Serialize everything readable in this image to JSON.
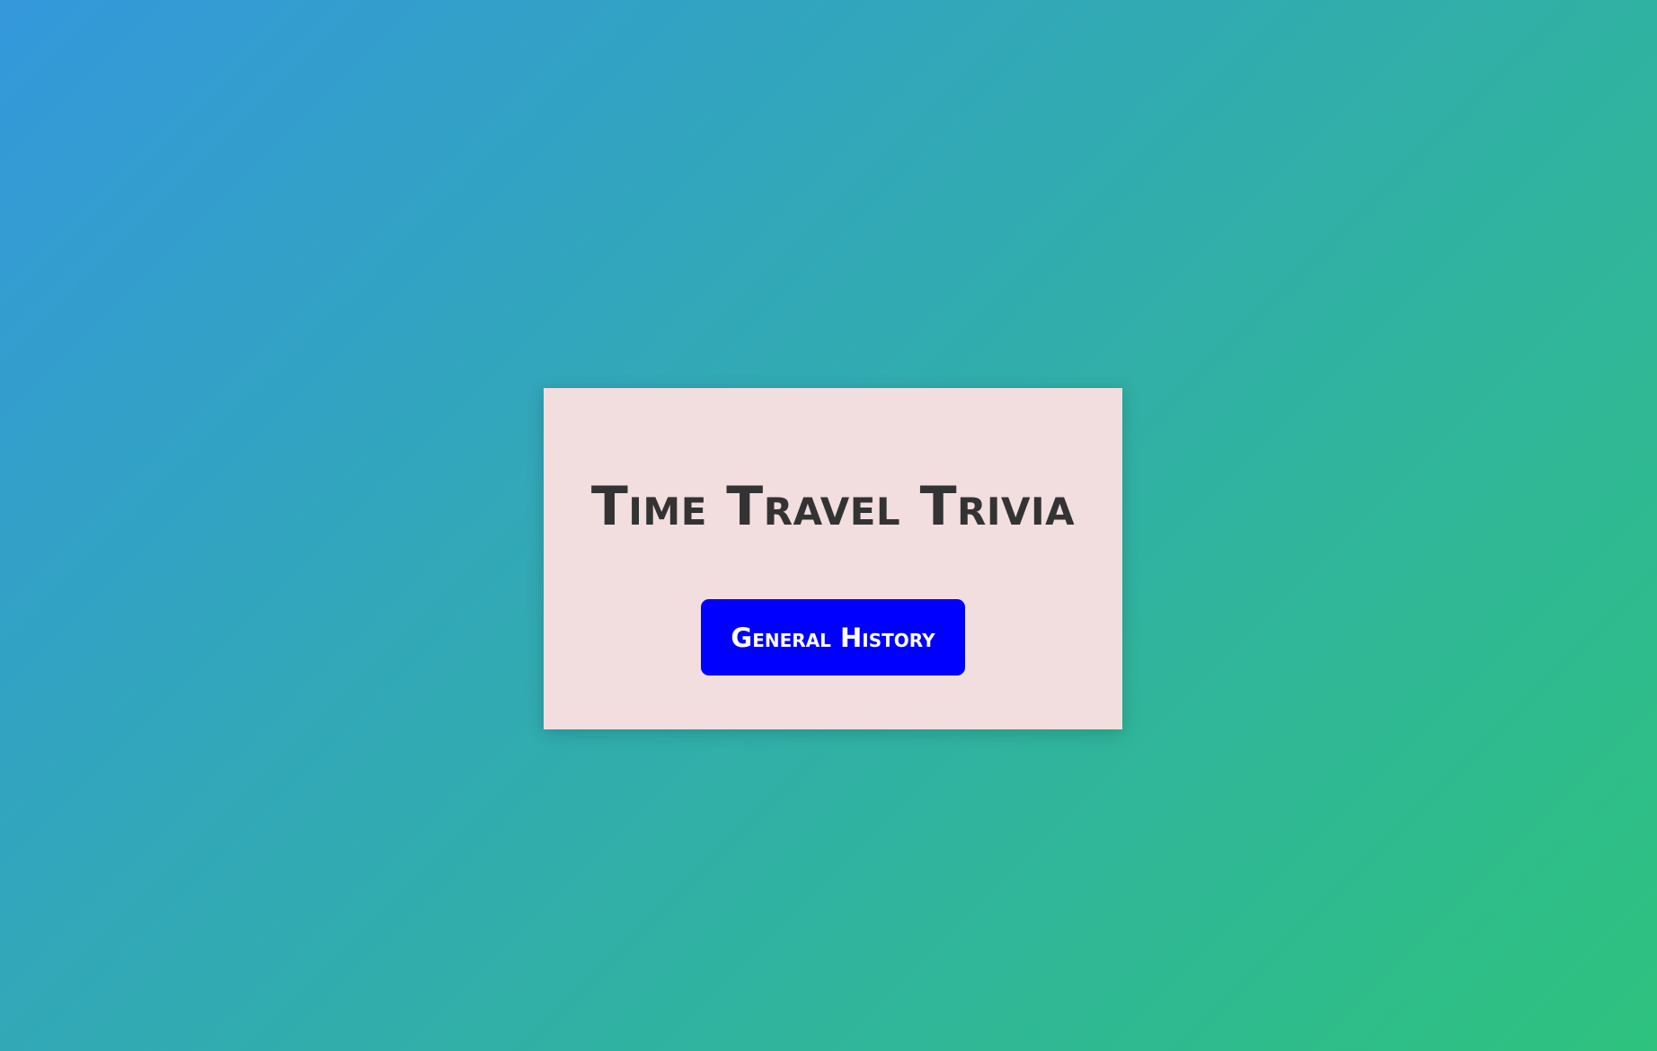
{
  "app": {
    "title": "Time Travel Trivia"
  },
  "categories": [
    {
      "label": "General History"
    }
  ],
  "colors": {
    "background_start": "#3498db",
    "background_end": "#2ec27e",
    "card_background": "#f2dede",
    "title_text": "#333333",
    "button_background": "#0000ff",
    "button_text": "#ffffff"
  }
}
